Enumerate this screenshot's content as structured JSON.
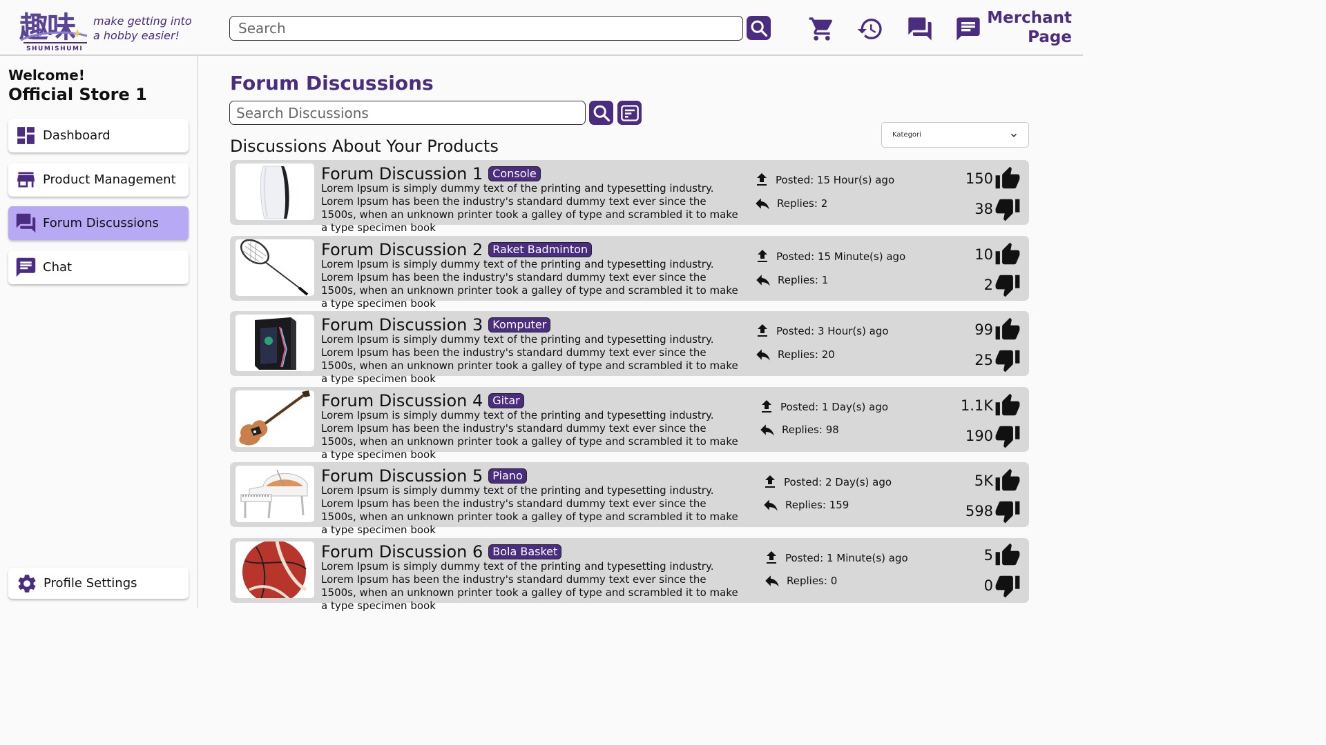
{
  "brand": {
    "logo_kanji": "趣味",
    "logo_word": "SHUMISHUMI",
    "tagline_line1": "make getting into",
    "tagline_line2": "a hobby easier!"
  },
  "header": {
    "search_placeholder": "Search",
    "icons": [
      "search-icon",
      "cart-icon",
      "history-icon",
      "forum-icon",
      "chat-icon"
    ],
    "merchant_line1": "Merchant",
    "merchant_line2": "Page"
  },
  "sidebar": {
    "welcome": "Welcome!",
    "store_name": "Official Store 1",
    "items": [
      {
        "label": "Dashboard",
        "icon": "dashboard-icon",
        "active": false
      },
      {
        "label": "Product Management",
        "icon": "store-icon",
        "active": true
      },
      {
        "label": "Forum Discussions",
        "icon": "forum-icon",
        "active": true
      },
      {
        "label": "Chat",
        "icon": "chat-icon",
        "active": false
      }
    ],
    "profile_label": "Profile Settings"
  },
  "main": {
    "title": "Forum Discussions",
    "search_placeholder": "Search Discussions",
    "section_title": "Discussions About Your Products",
    "kategori_label": "Kategori"
  },
  "discussions": [
    {
      "title": "Forum Discussion 1",
      "tag": "Console",
      "image": "console-image",
      "description": "Lorem Ipsum is simply dummy text of the printing and typesetting industry. Lorem Ipsum has been the industry's standard dummy text ever since the 1500s, when an unknown printer took a galley of type and scrambled it to make a type specimen book",
      "posted": "Posted: 15 Hour(s) ago",
      "replies": "Replies: 2",
      "likes": "150",
      "dislikes": "38"
    },
    {
      "title": "Forum Discussion 2",
      "tag": "Raket Badminton",
      "image": "badminton-racket-image",
      "description": "Lorem Ipsum is simply dummy text of the printing and typesetting industry. Lorem Ipsum has been the industry's standard dummy text ever since the 1500s, when an unknown printer took a galley of type and scrambled it to make a type specimen book",
      "posted": "Posted: 15 Minute(s) ago",
      "replies": "Replies: 1",
      "likes": "10",
      "dislikes": "2"
    },
    {
      "title": "Forum Discussion 3",
      "tag": "Komputer",
      "image": "computer-case-image",
      "description": "Lorem Ipsum is simply dummy text of the printing and typesetting industry. Lorem Ipsum has been the industry's standard dummy text ever since the 1500s, when an unknown printer took a galley of type and scrambled it to make a type specimen book",
      "posted": "Posted: 3 Hour(s) ago",
      "replies": "Replies: 20",
      "likes": "99",
      "dislikes": "25"
    },
    {
      "title": "Forum Discussion 4",
      "tag": "Gitar",
      "image": "guitar-image",
      "description": "Lorem Ipsum is simply dummy text of the printing and typesetting industry. Lorem Ipsum has been the industry's standard dummy text ever since the 1500s, when an unknown printer took a galley of type and scrambled it to make a type specimen book",
      "posted": "Posted: 1 Day(s) ago",
      "replies": "Replies: 98",
      "likes": "1.1K",
      "dislikes": "190"
    },
    {
      "title": "Forum Discussion 5",
      "tag": "Piano",
      "image": "piano-image",
      "description": "Lorem Ipsum is simply dummy text of the printing and typesetting industry. Lorem Ipsum has been the industry's standard dummy text ever since the 1500s, when an unknown printer took a galley of type and scrambled it to make a type specimen book",
      "posted": "Posted: 2 Day(s) ago",
      "replies": "Replies: 159",
      "likes": "5K",
      "dislikes": "598"
    },
    {
      "title": "Forum Discussion 6",
      "tag": "Bola Basket",
      "image": "basketball-image",
      "description": "Lorem Ipsum is simply dummy text of the printing and typesetting industry. Lorem Ipsum has been the industry's standard dummy text ever since the 1500s, when an unknown printer took a galley of type and scrambled it to make a type specimen book",
      "posted": "Posted: 1 Minute(s) ago",
      "replies": "Replies: 0",
      "likes": "5",
      "dislikes": "0"
    }
  ],
  "colors": {
    "accent": "#4a2c80",
    "active_nav": "#b7a9f4",
    "card_bg": "#d8d8d8"
  }
}
